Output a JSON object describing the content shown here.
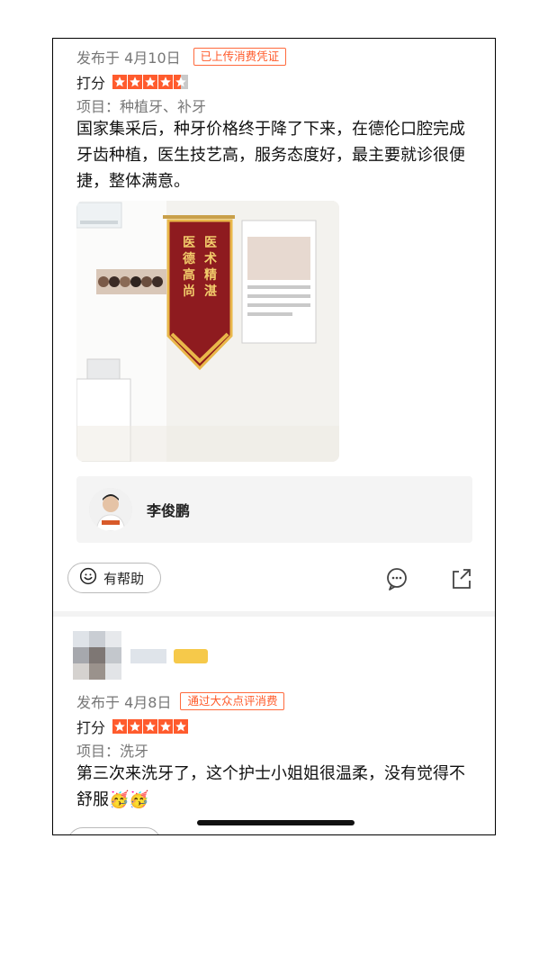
{
  "review1": {
    "posted": "发布于 4月10日",
    "badge": "已上传消费凭证",
    "rating_label": "打分",
    "rating": 4.5,
    "project": "项目：种植牙、补牙",
    "text": "国家集采后，种牙价格终于降了下来，在德伦口腔完成牙齿种植，医生技艺高，服务态度好，最主要就诊很便捷，整体满意。",
    "photo_banner_left": "医德高尚",
    "photo_banner_right": "医术精湛",
    "doctor_name": "李俊鹏",
    "helpful_label": "有帮助"
  },
  "review2": {
    "posted": "发布于 4月8日",
    "badge": "通过大众点评消费",
    "rating_label": "打分",
    "rating": 5,
    "project": "项目：洗牙",
    "text": "第三次来洗牙了，这个护士小姐姐很温柔，没有觉得不舒服🥳🥳"
  },
  "colors": {
    "accent": "#ff5b2d",
    "banner": "#8e1b1f",
    "gold": "#e9b84a"
  },
  "icons": [
    "smile-icon",
    "comment-icon",
    "share-icon",
    "star-icon"
  ]
}
